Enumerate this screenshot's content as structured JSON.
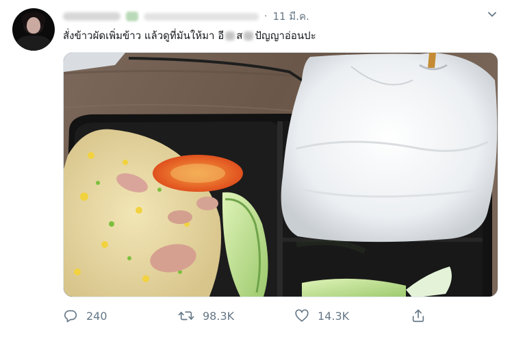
{
  "tweet": {
    "date": "11 มี.ค.",
    "separator": "·",
    "text_part1": "สั่งข้าวผัดเพิ่มข้าว แล้วดูที่มันให้มา อี",
    "text_part2": "ส",
    "text_part3": "ปัญญาอ่อนปะ",
    "media": {
      "description_icon": "food-photo"
    }
  },
  "actions": {
    "reply_count": "240",
    "retweet_count": "98.3K",
    "like_count": "14.3K"
  },
  "icons": {
    "reply": "reply-icon",
    "retweet": "retweet-icon",
    "like": "heart-icon",
    "share": "share-icon",
    "more": "chevron-down-icon"
  },
  "colors": {
    "text": "#14171a",
    "muted": "#657786",
    "border": "#e1e8ed"
  }
}
